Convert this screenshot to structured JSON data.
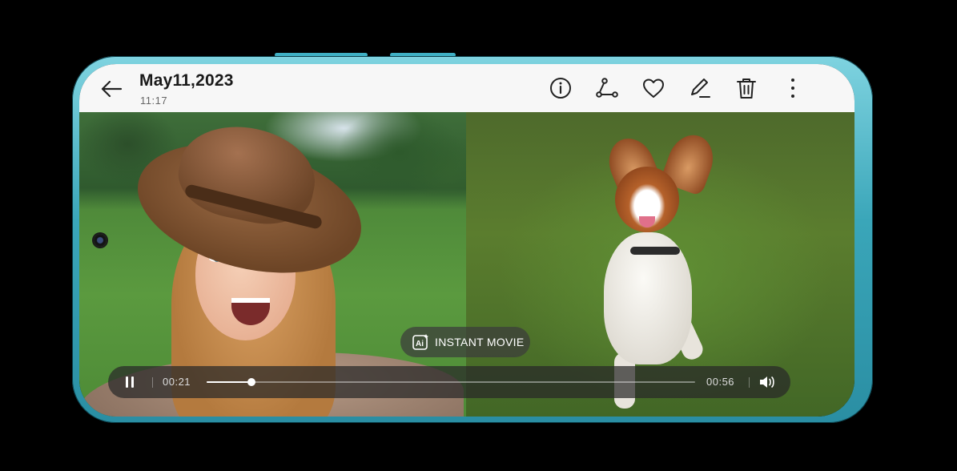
{
  "header": {
    "title": "May11,2023",
    "time": "11:17"
  },
  "toolbar": {
    "icons": [
      "info-icon",
      "share-icon",
      "heart-icon",
      "edit-icon",
      "delete-icon",
      "more-icon"
    ]
  },
  "instant_movie": {
    "label": "INSTANT MOVIE",
    "icon": "ai-icon"
  },
  "player": {
    "current_time": "00:21",
    "total_time": "00:56",
    "progress": 0.092
  },
  "colors": {
    "frame": "#3aa6b9",
    "topbar": "#f7f7f7",
    "overlay": "#282828"
  }
}
